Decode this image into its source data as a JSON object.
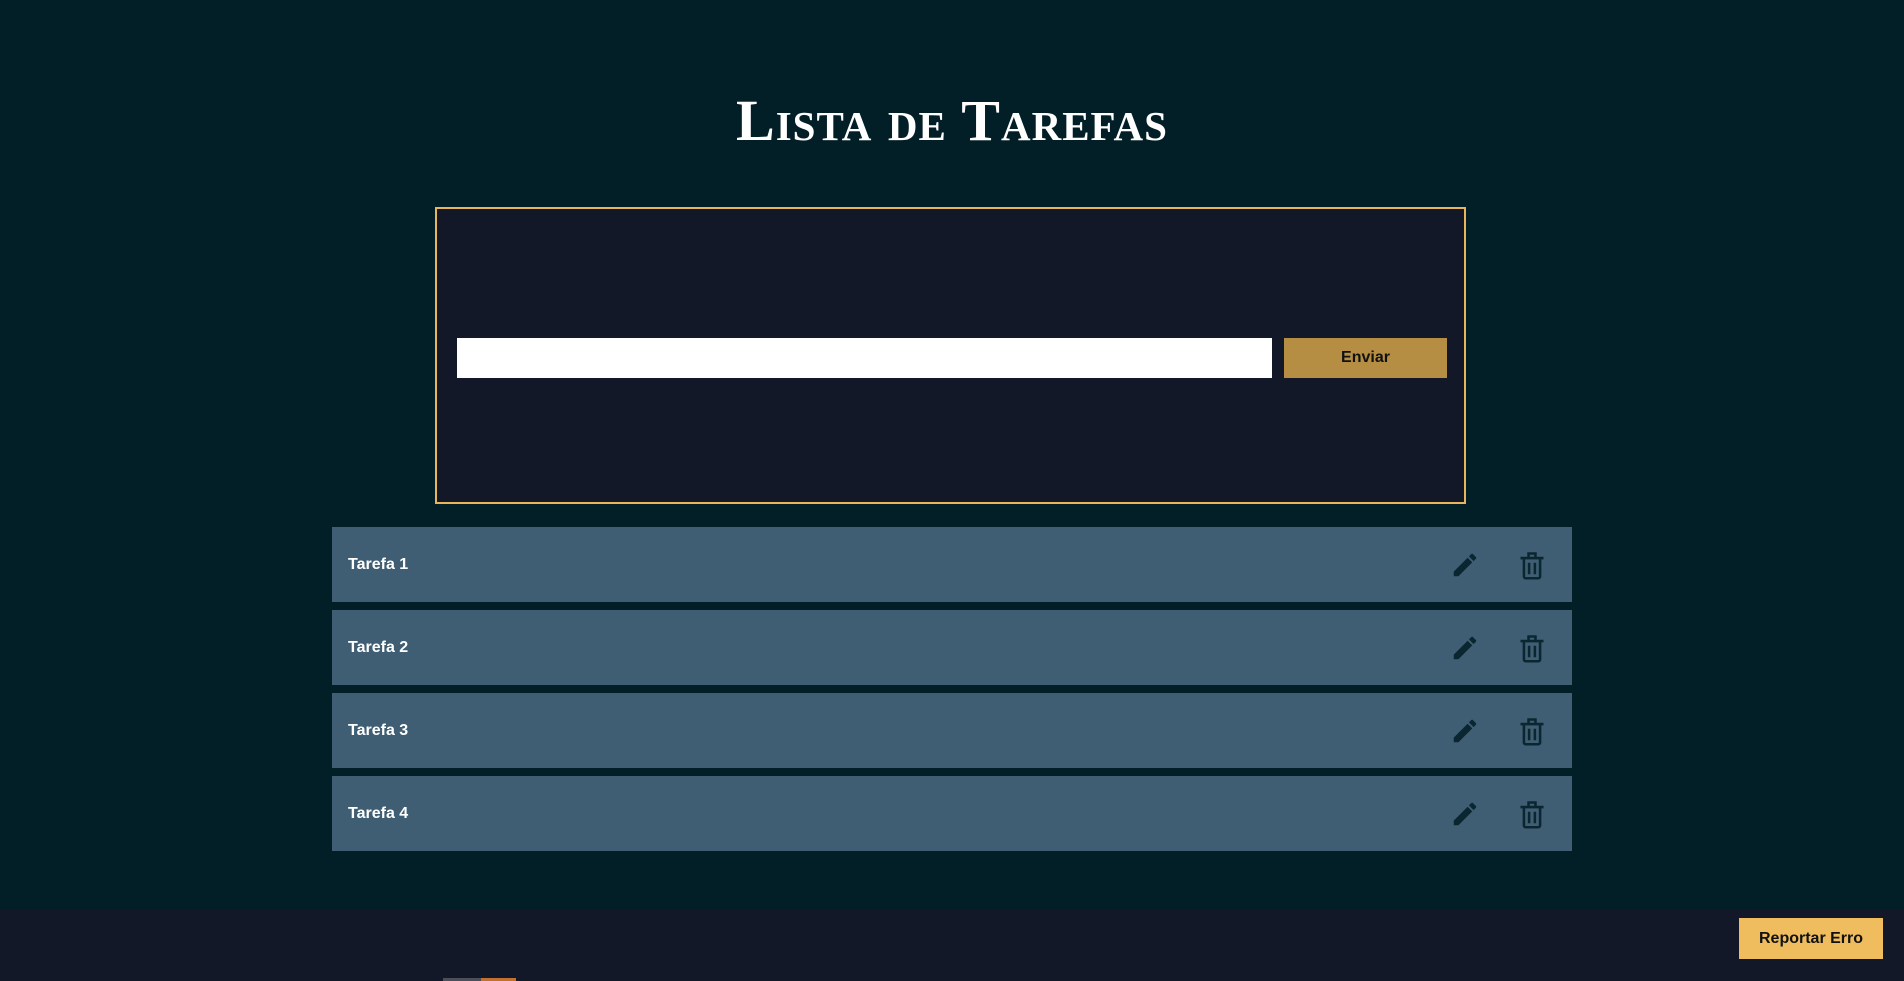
{
  "header": {
    "title": "Lista de Tarefas"
  },
  "form": {
    "input_value": "",
    "input_placeholder": "",
    "submit_label": "Enviar"
  },
  "tasks": [
    {
      "label": "Tarefa 1",
      "edit_icon": "pencil-icon",
      "delete_icon": "trash-icon"
    },
    {
      "label": "Tarefa 2",
      "edit_icon": "pencil-icon",
      "delete_icon": "trash-icon"
    },
    {
      "label": "Tarefa 3",
      "edit_icon": "pencil-icon",
      "delete_icon": "trash-icon"
    },
    {
      "label": "Tarefa 4",
      "edit_icon": "pencil-icon",
      "delete_icon": "trash-icon"
    }
  ],
  "footer": {
    "report_label": "Reportar Erro"
  },
  "colors": {
    "background": "#021e26",
    "panel": "#121828",
    "accent_border": "#e9b55a",
    "submit_button": "#b58e44",
    "task_row": "#3f5e73",
    "icon": "#0a2630",
    "report_button": "#f0bd5e"
  }
}
